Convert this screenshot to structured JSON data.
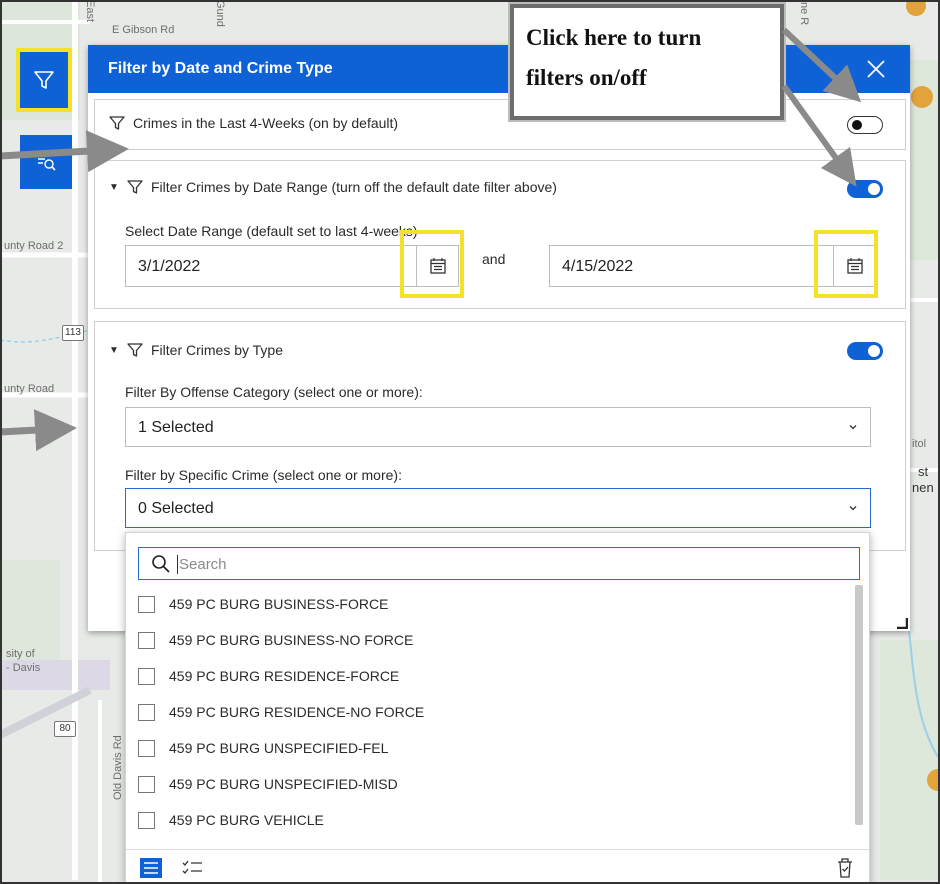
{
  "map": {
    "labels": {
      "gibson_rd": "E Gibson Rd",
      "east": "East",
      "gund": "Gund",
      "re": "ne R",
      "county_road_a": "unty Road 2",
      "county_road_b": "unty Road",
      "shield_113": "113",
      "univ_1": "sity of",
      "univ_2": "- Davis",
      "shield_80": "80",
      "old_davis": "Old Davis Rd",
      "itol": "itol",
      "st": "st",
      "nen": "nen"
    }
  },
  "tools": {
    "filter_icon": "filter-icon",
    "query_icon": "query-icon"
  },
  "panel": {
    "title": "Filter by Date and Crime Type",
    "close_icon": "close-icon",
    "last4": {
      "label": "Crimes in the Last 4-Weeks (on by default)",
      "enabled": false
    },
    "date_range": {
      "label": "Filter Crimes by Date Range (turn off the default date filter above)",
      "enabled": true,
      "field_label": "Select Date Range (default set to last 4-weeks)",
      "start": "3/1/2022",
      "between": "and",
      "end": "4/15/2022"
    },
    "crime_type": {
      "label": "Filter Crimes by Type",
      "enabled": true,
      "offense_label": "Filter By Offense Category (select one or more):",
      "offense_value": "1 Selected",
      "specific_label": "Filter by Specific Crime (select one or more):",
      "specific_value": "0 Selected"
    }
  },
  "dropdown": {
    "search_placeholder": "Search",
    "items": [
      "459 PC BURG BUSINESS-FORCE",
      "459 PC BURG BUSINESS-NO FORCE",
      "459 PC BURG RESIDENCE-FORCE",
      "459 PC BURG RESIDENCE-NO FORCE",
      "459 PC BURG UNSPECIFIED-FEL",
      "459 PC BURG UNSPECIFIED-MISD",
      "459 PC BURG VEHICLE"
    ]
  },
  "callout": {
    "line1": "Click here to turn",
    "line2": "filters on/off"
  },
  "colors": {
    "accent": "#0f62d6",
    "highlight": "#f4e12a",
    "arrow": "#8a8a8a"
  }
}
